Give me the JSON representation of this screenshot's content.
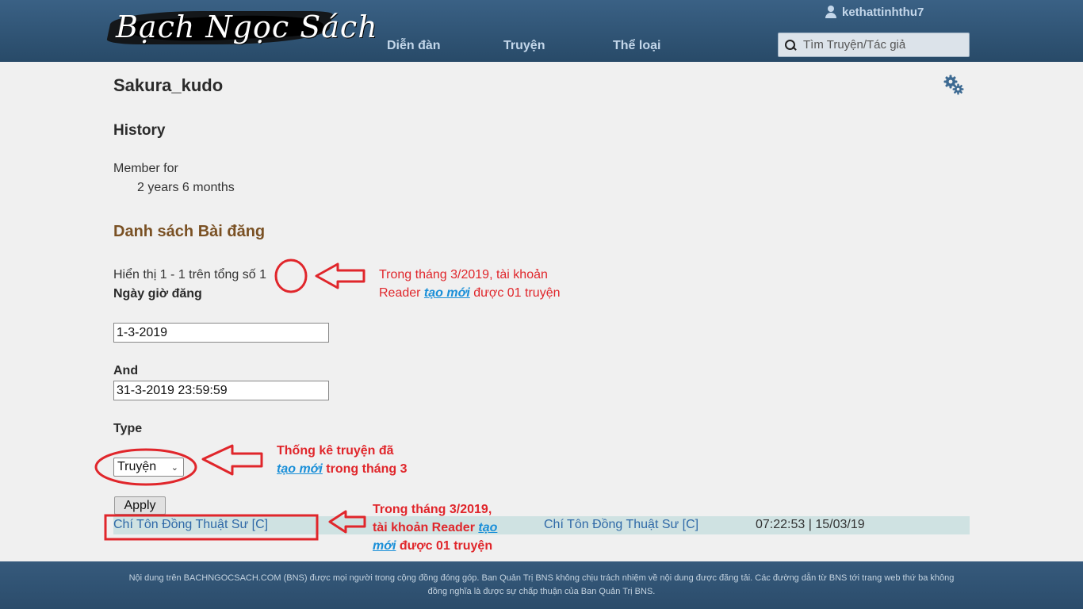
{
  "header": {
    "logo_text": "Bạch Ngọc Sách",
    "nav": [
      "Diễn đàn",
      "Truyện",
      "Thể loại"
    ],
    "username": "kethattinhthu7",
    "search_placeholder": "Tìm Truyện/Tác giả"
  },
  "profile": {
    "name": "Sakura_kudo",
    "history_heading": "History",
    "member_for_label": "Member for",
    "member_for_value": "2 years 6 months"
  },
  "posts": {
    "title": "Danh sách Bài đăng",
    "showing": "Hiển thị 1 - 1 trên tổng số 1",
    "date_label": "Ngày giờ đăng",
    "date_from": "1-3-2019",
    "and_label": "And",
    "date_to": "31-3-2019 23:59:59",
    "type_label": "Type",
    "type_selected": "Truyện",
    "apply_label": "Apply",
    "result": {
      "title": "Chí Tôn Đồng Thuật Sư [C]",
      "story": "Chí Tôn Đồng Thuật Sư [C]",
      "datetime": "07:22:53 | 15/03/19"
    }
  },
  "footer": {
    "text": "Nội dung trên BACHNGOCSACH.COM (BNS) được mọi người trong cộng đồng đóng góp. Ban Quản Trị BNS không chịu trách nhiệm về nội dung được đăng tải. Các đường dẫn từ BNS tới trang web thứ ba không đồng nghĩa là được sự chấp thuận của Ban Quản Trị BNS."
  },
  "annotations": {
    "a1_line1": "Trong tháng 3/2019, tài khoản",
    "a1_pre": "Reader ",
    "a1_link": "tạo mới",
    "a1_post": " được 01 truyện",
    "a2_line1": "Thống kê truyện đã",
    "a2_link": "tạo mới",
    "a2_post": " trong tháng 3",
    "a3_line1": "Trong tháng 3/2019,",
    "a3_pre": "tài khoản Reader ",
    "a3_link1": "tạo",
    "a3_link2": "mới",
    "a3_post": " được 01 truyện"
  },
  "icons": [
    "user-icon",
    "search-icon",
    "gear-icon"
  ],
  "colors": {
    "header_bg": "#2d4f6d",
    "annotation_red": "#e0262b",
    "posts_title": "#7a5124",
    "link": "#2f69a7",
    "row_bg": "#cfe2e2"
  }
}
